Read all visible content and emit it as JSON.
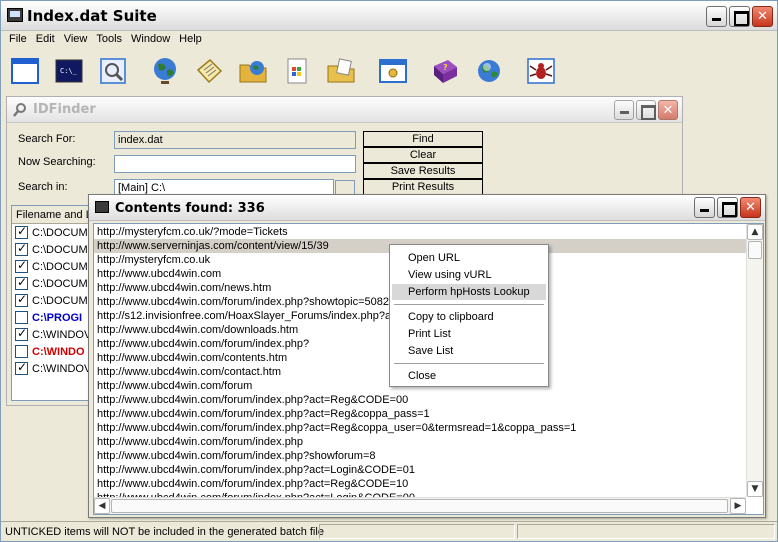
{
  "app": {
    "title": "Index.dat Suite",
    "menu": [
      "File",
      "Edit",
      "View",
      "Tools",
      "Window",
      "Help"
    ],
    "toolbar": [
      {
        "name": "blank-window-icon",
        "color": "#1f5fd0"
      },
      {
        "name": "console-icon",
        "color": "#101860"
      },
      {
        "name": "magnifier-window-icon",
        "color": "#5b8fd8"
      },
      {
        "name": "globe-icon",
        "color": "#2e7d32"
      },
      {
        "name": "notepad-icon",
        "color": "#d9b73a"
      },
      {
        "name": "folder-globe-icon",
        "color": "#e3b33e"
      },
      {
        "name": "windows-document-icon",
        "color": "#4a86c7"
      },
      {
        "name": "folder-document-icon",
        "color": "#e7c04e"
      },
      {
        "name": "settings-window-icon",
        "color": "#2c6fd0"
      },
      {
        "name": "help-book-icon",
        "color": "#7b2f9e"
      },
      {
        "name": "globe-arrow-icon",
        "color": "#2d8a3c"
      },
      {
        "name": "spider-icon",
        "color": "#b22222"
      }
    ],
    "status": "UNTICKED items will NOT be included in the generated batch file"
  },
  "idfinder": {
    "title": "IDFinder",
    "search_for_label": "Search For:",
    "search_for_value": "index.dat",
    "now_searching_label": "Now Searching:",
    "now_searching_value": "",
    "search_in_label": "Search in:",
    "search_in_value": "[Main] C:\\",
    "buttons": {
      "find": "Find",
      "clear": "Clear",
      "save": "Save Results",
      "print": "Print Results"
    },
    "list_header": "Filename and L",
    "files": [
      {
        "path": "C:\\DOCUM",
        "checked": true,
        "style": "normal"
      },
      {
        "path": "C:\\DOCUM",
        "checked": true,
        "style": "normal"
      },
      {
        "path": "C:\\DOCUM",
        "checked": true,
        "style": "normal"
      },
      {
        "path": "C:\\DOCUM",
        "checked": true,
        "style": "normal"
      },
      {
        "path": "C:\\DOCUM",
        "checked": true,
        "style": "normal"
      },
      {
        "path": "C:\\PROGI",
        "checked": false,
        "style": "blue"
      },
      {
        "path": "C:\\WINDOV",
        "checked": true,
        "style": "normal"
      },
      {
        "path": "C:\\WINDO",
        "checked": false,
        "style": "red"
      },
      {
        "path": "C:\\WINDOV",
        "checked": true,
        "style": "normal"
      }
    ]
  },
  "contents": {
    "title": "Contents found: 336",
    "selected_index": 1,
    "urls": [
      "http://mysteryfcm.co.uk/?mode=Tickets",
      "http://www.serverninjas.com/content/view/15/39",
      "http://mysteryfcm.co.uk",
      "http://www.ubcd4win.com",
      "http://www.ubcd4win.com/news.htm",
      "http://www.ubcd4win.com/forum/index.php?showtopic=5082",
      "http://s12.invisionfree.com/HoaxSlayer_Forums/index.php?ac",
      "http://www.ubcd4win.com/downloads.htm",
      "http://www.ubcd4win.com/forum/index.php?",
      "http://www.ubcd4win.com/contents.htm",
      "http://www.ubcd4win.com/contact.htm",
      "http://www.ubcd4win.com/forum",
      "http://www.ubcd4win.com/forum/index.php?act=Reg&CODE=00",
      "http://www.ubcd4win.com/forum/index.php?act=Reg&coppa_pass=1",
      "http://www.ubcd4win.com/forum/index.php?act=Reg&coppa_user=0&termsread=1&coppa_pass=1",
      "http://www.ubcd4win.com/forum/index.php",
      "http://www.ubcd4win.com/forum/index.php?showforum=8",
      "http://www.ubcd4win.com/forum/index.php?act=Login&CODE=01",
      "http://www.ubcd4win.com/forum/index.php?act=Reg&CODE=10",
      "http://www.ubcd4win.com/forum/index.php?act=Login&CODE=00"
    ]
  },
  "context_menu": {
    "group1": [
      "Open URL",
      "View using vURL",
      "Perform hpHosts Lookup"
    ],
    "highlighted": "Perform hpHosts Lookup",
    "group2": [
      "Copy to clipboard",
      "Print List",
      "Save List"
    ],
    "group3": [
      "Close"
    ]
  }
}
